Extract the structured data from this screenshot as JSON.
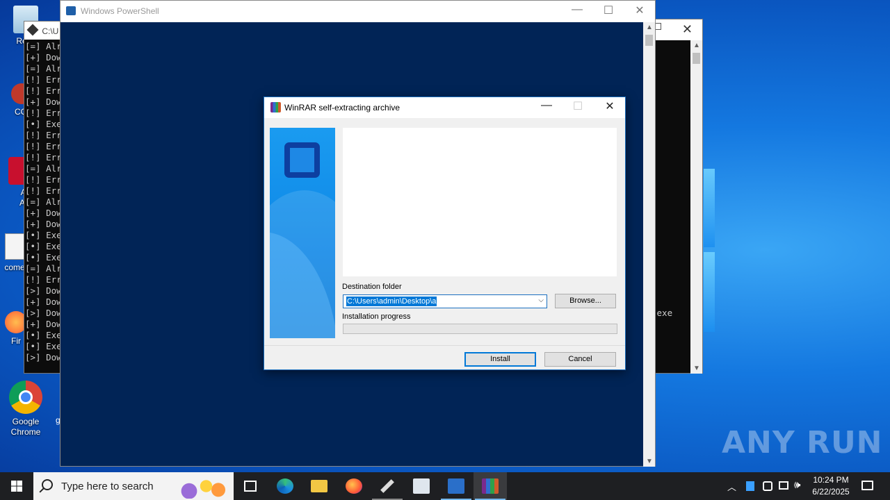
{
  "desktop": {
    "icons": [
      {
        "label": "Recy",
        "name": "recycle-bin"
      },
      {
        "label": "CCl",
        "name": "ccleaner"
      },
      {
        "label": "Ad Acr",
        "name": "adobe-acrobat"
      },
      {
        "label": "come",
        "name": "come-file"
      },
      {
        "label": "Fir",
        "name": "firefox"
      },
      {
        "label": "Google Chrome",
        "name": "google-chrome"
      }
    ],
    "stray_char": "g"
  },
  "cmd_left": {
    "title": "C:\\U",
    "lines": [
      "[=] Alr",
      "[+] Dow",
      "[=] Alr",
      "[!] Err",
      "[!] Err",
      "[+] Dow",
      "[!] Err",
      "[•] Exe",
      "[!] Err",
      "[!] Err",
      "[!] Err",
      "[=] Alr",
      "[!] Err",
      "[!] Err",
      "[=] Alr",
      "[+] Dow",
      "[+] Dow",
      "[•] Exe",
      "[•] Exe",
      "[•] Exe",
      "[=] Alr",
      "[!] Err",
      "[>] Dow",
      "[+] Dow",
      "[>] Dow",
      "[+] Dow",
      "[•] Exe",
      "[•] Exe",
      "[>] Dow"
    ]
  },
  "cmd_right": {
    "visible_text": ".exe"
  },
  "powershell": {
    "title": "Windows PowerShell",
    "minimize": "—",
    "maximize": "☐",
    "close": "✕"
  },
  "winrar": {
    "title": "WinRAR self-extracting archive",
    "minimize": "—",
    "maximize": "☐",
    "close": "✕",
    "destination_label": "Destination folder",
    "destination_value": "C:\\Users\\admin\\Desktop\\a",
    "browse_label": "Browse...",
    "progress_label": "Installation progress",
    "progress": 0,
    "install_label": "Install",
    "cancel_label": "Cancel"
  },
  "watermark": "ANY RUN",
  "taskbar": {
    "search_placeholder": "Type here to search",
    "apps": [
      "start",
      "task-view",
      "edge",
      "file-explorer",
      "firefox",
      "tool",
      "network-monitor",
      "powershell",
      "winrar"
    ],
    "time": "10:24 PM",
    "date": "6/22/2025"
  },
  "colors": {
    "accent": "#0078d7",
    "powershell_bg": "#012456",
    "taskbar_bg": "#1e1f22"
  }
}
